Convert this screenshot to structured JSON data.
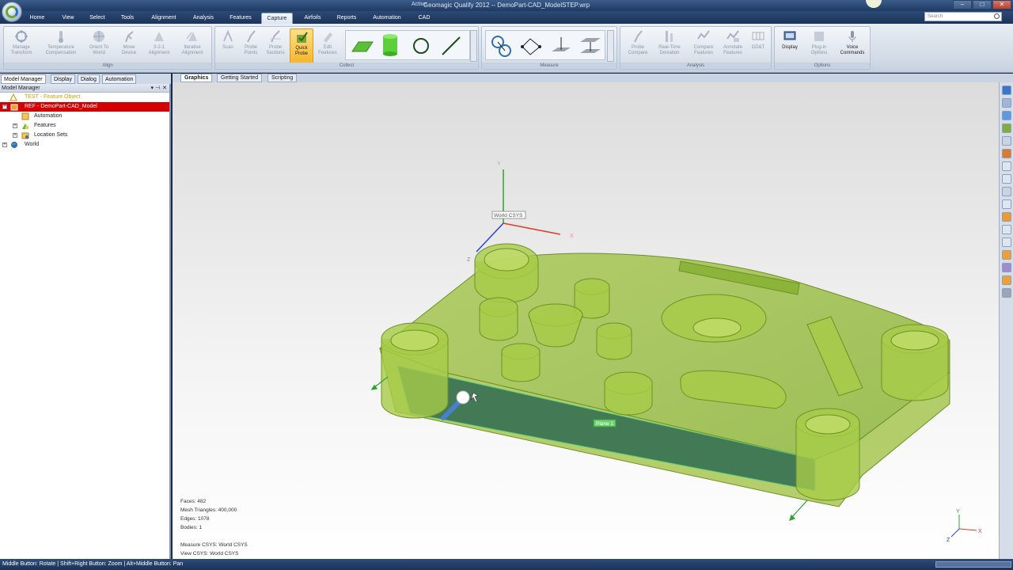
{
  "window": {
    "title": "Geomagic Qualify 2012 -- DemoPart-CAD_ModelSTEP.wrp",
    "active_label": "Active"
  },
  "menu": {
    "tabs": [
      "Home",
      "View",
      "Select",
      "Tools",
      "Alignment",
      "Analysis",
      "Features",
      "Capture",
      "Airfoils",
      "Reports",
      "Automation",
      "CAD"
    ],
    "active": "Capture"
  },
  "search": {
    "placeholder": "Search"
  },
  "ribbon": {
    "groups": {
      "align": {
        "label": "Align",
        "buttons": [
          {
            "label": "Manage\nTransform",
            "icon": "transform-icon"
          },
          {
            "label": "Temperature\nCompensation",
            "icon": "temperature-icon"
          },
          {
            "label": "Orient To\nWorld",
            "icon": "orient-world-icon"
          },
          {
            "label": "Move\nDevice",
            "icon": "move-device-icon"
          },
          {
            "label": "3-2-1\nAlignment",
            "icon": "alignment-321-icon"
          },
          {
            "label": "Iterative\nAlignment",
            "icon": "iterative-alignment-icon"
          }
        ]
      },
      "collect": {
        "label": "Collect",
        "buttons": [
          {
            "label": "Scan",
            "icon": "scan-icon"
          },
          {
            "label": "Probe\nPoints",
            "icon": "probe-points-icon"
          },
          {
            "label": "Probe\nSections",
            "icon": "probe-sections-icon"
          },
          {
            "label": "Quick\nProbe",
            "icon": "quick-probe-icon"
          },
          {
            "label": "Edit\nFeatures",
            "icon": "edit-features-icon"
          }
        ],
        "gallery": [
          "plane-icon",
          "cylinder-icon",
          "circle-icon",
          "line-icon"
        ]
      },
      "measure": {
        "label": "Measure",
        "gallery": [
          "distance-circles-icon",
          "distance-points-icon",
          "point-to-plane-icon",
          "plane-to-plane-icon"
        ]
      },
      "analysis": {
        "label": "Analysis",
        "buttons": [
          {
            "label": "Probe\nCompare",
            "icon": "probe-compare-icon"
          },
          {
            "label": "Real-Time\nDeviation",
            "icon": "realtime-deviation-icon"
          },
          {
            "label": "Compare\nFeatures",
            "icon": "compare-features-icon"
          },
          {
            "label": "Annotate\nFeatures",
            "icon": "annotate-features-icon"
          },
          {
            "label": "GD&T",
            "icon": "gdt-icon"
          }
        ]
      },
      "options": {
        "label": "Options",
        "buttons": [
          {
            "label": "Display",
            "icon": "display-icon"
          },
          {
            "label": "Plug-in\nOptions",
            "icon": "plugin-options-icon"
          },
          {
            "label": "Voice\nCommands",
            "icon": "microphone-icon"
          }
        ]
      }
    }
  },
  "panel": {
    "tabs": [
      "Model Manager",
      "Display",
      "Dialog",
      "Automation"
    ],
    "header": "Model Manager",
    "tree": [
      {
        "label": "TEST - Feature Object",
        "icon": "feature-object-icon",
        "indent": 0
      },
      {
        "label": "REF - DemoPart-CAD_Model",
        "icon": "cad-model-icon",
        "indent": 0,
        "selected": true
      },
      {
        "label": "Automation",
        "icon": "automation-icon",
        "indent": 1
      },
      {
        "label": "Features",
        "icon": "features-icon",
        "indent": 1
      },
      {
        "label": "Location Sets",
        "icon": "location-sets-icon",
        "indent": 1
      },
      {
        "label": "World",
        "icon": "world-icon",
        "indent": 0
      }
    ]
  },
  "viewport": {
    "tabs": [
      "Graphics",
      "Getting Started",
      "Scripting"
    ],
    "active_tab": "Graphics",
    "csys_label": "World CSYS",
    "plane_label": "Plane 1",
    "axis_labels": {
      "x": "X",
      "y": "Y",
      "z": "Z"
    },
    "info": [
      "Faces: 482",
      "Mesh Triangles: 400,000",
      "Edges: 1078",
      "Bodies: 1",
      "",
      "Measure CSYS: World CSYS",
      "View CSYS: World CSYS"
    ]
  },
  "statusbar": {
    "text": "Middle Button: Rotate | Shift+Right Button: Zoom | Alt+Middle Button: Pan"
  },
  "colors": {
    "model_fill": "#9bbf3a",
    "model_edge": "#6f9126",
    "plane_fill": "#2f6b52",
    "selected_row": "#d40000",
    "accent": "#f7b52a"
  }
}
